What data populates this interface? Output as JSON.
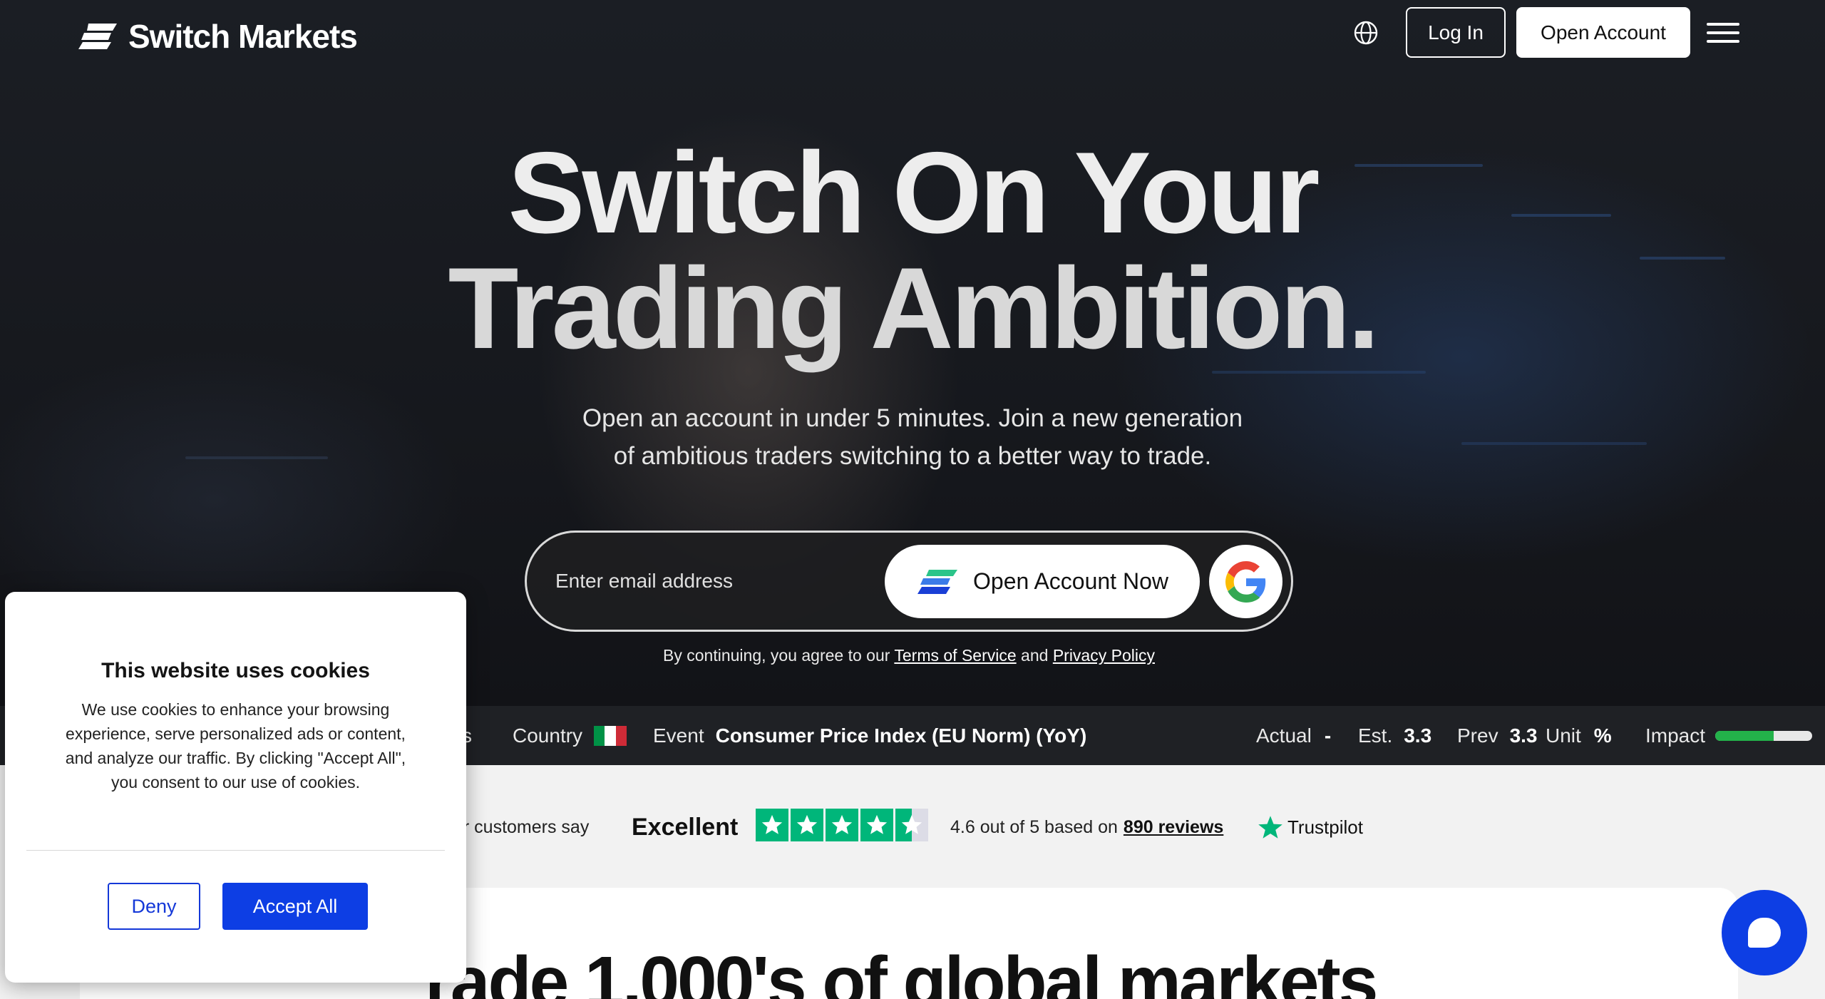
{
  "brand": {
    "name": "Switch Markets"
  },
  "nav": {
    "login_label": "Log In",
    "open_account_label": "Open Account"
  },
  "hero": {
    "title_line1": "Switch On Your",
    "title_line2": "Trading Ambition.",
    "subtitle_line1": "Open an account in under 5 minutes. Join a new generation",
    "subtitle_line2": "of ambitious traders switching to a better way to trade."
  },
  "signup": {
    "email_placeholder": "Enter email address",
    "open_now_label": "Open Account Now",
    "terms_prefix": "By continuing, you agree to our",
    "terms_link": "Terms of Service",
    "terms_and": "and",
    "privacy_link": "Privacy Policy"
  },
  "ticker": {
    "cut_label": "s",
    "country_label": "Country",
    "event_label": "Event",
    "event_value": "Consumer Price Index (EU Norm) (YoY)",
    "actual_label": "Actual",
    "actual_value": "-",
    "est_label": "Est.",
    "est_value": "3.3",
    "prev_label": "Prev",
    "prev_value": "3.3",
    "unit_label": "Unit",
    "unit_value": "%",
    "impact_label": "Impact",
    "impact_level": 0.6,
    "flag_colors": [
      "#009246",
      "#ffffff",
      "#ce2b37"
    ]
  },
  "trust": {
    "say_label": "ur customers say",
    "rating_word": "Excellent",
    "score_text": "4.6 out of 5 based on",
    "reviews_link": "890 reviews",
    "provider": "Trustpilot",
    "rating": 4.6
  },
  "main": {
    "headline_partial": "rade 1,000's of global markets"
  },
  "cookie": {
    "title": "This website uses cookies",
    "body": "We use cookies to enhance your browsing experience, serve personalized ads or content, and analyze our traffic. By clicking \"Accept All\", you consent to our use of cookies.",
    "deny_label": "Deny",
    "accept_label": "Accept All"
  },
  "colors": {
    "accent": "#0d3ee4",
    "trustpilot_green": "#00b67a",
    "ticker_bg": "#1f2125"
  },
  "icons": [
    "logo-icon",
    "globe-icon",
    "menu-icon",
    "switch-logo-icon",
    "google-icon",
    "star-icon",
    "trustpilot-icon",
    "chat-icon"
  ]
}
